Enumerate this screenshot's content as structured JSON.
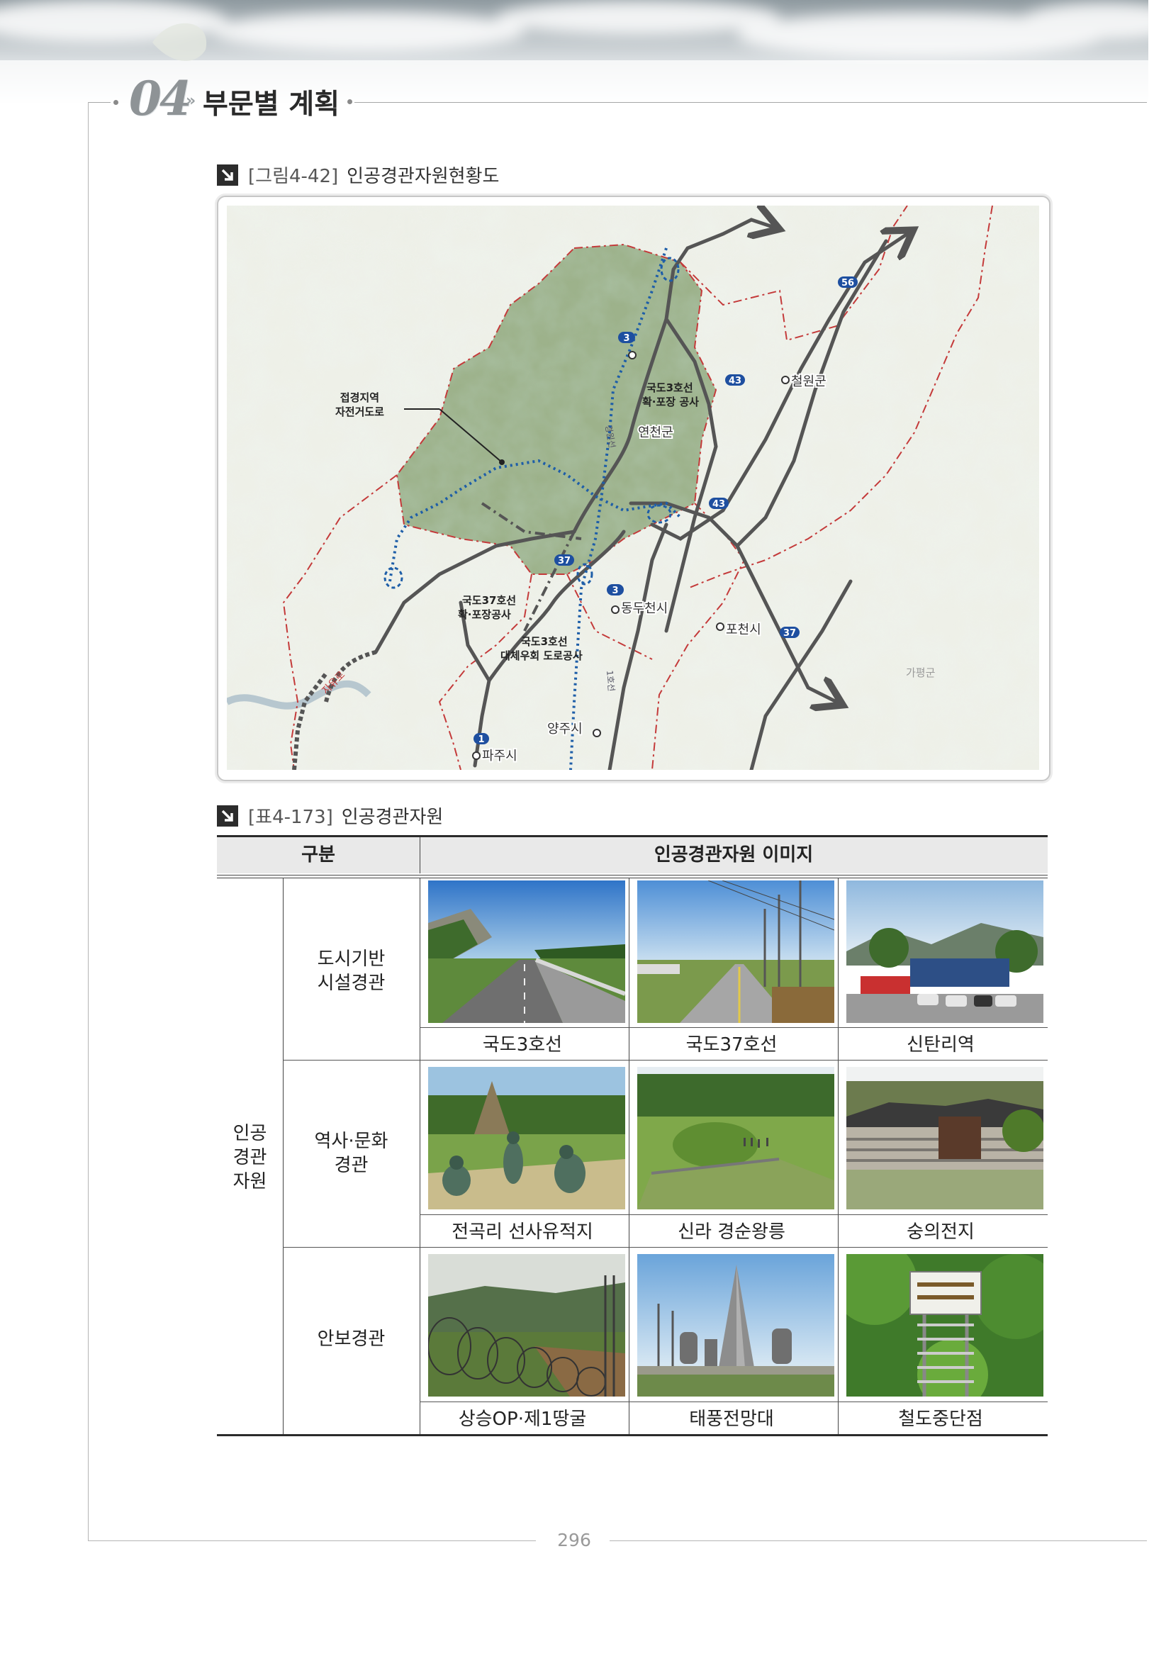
{
  "header": {
    "chapter_number": "04",
    "chapter_title": "부문별 계획"
  },
  "figure": {
    "number": "[그림4-42]",
    "title": "인공경관자원현황도",
    "map_labels": {
      "bike_road": [
        "접경지역",
        "자전거도로"
      ],
      "route3_work": [
        "국도3호선",
        "확·포장 공사"
      ],
      "route37_work": [
        "국도37호선",
        "확·포장공사"
      ],
      "route3_bypass": [
        "국도3호선",
        "대체우회 도로공사"
      ],
      "yeoncheon": "연천군",
      "cheorwon": "철원군",
      "dongducheon": "동두천시",
      "pocheon": "포천시",
      "yangju": "양주시",
      "paju": "파주시",
      "gapyeong": "가평군",
      "jayuro": "자유로",
      "gyeongwon_line": "경원선",
      "line1": "1호선"
    },
    "route_badges": [
      "3",
      "3",
      "37",
      "43",
      "43",
      "56",
      "37",
      "1"
    ]
  },
  "table": {
    "number": "[표4-173]",
    "title": "인공경관자원",
    "header": {
      "category": "구분",
      "images": "인공경관자원 이미지"
    },
    "group": "인공\n경관\n자원",
    "rows": [
      {
        "subcategory": "도시기반\n시설경관",
        "items": [
          "국도3호선",
          "국도37호선",
          "신탄리역"
        ]
      },
      {
        "subcategory": "역사·문화\n경관",
        "items": [
          "전곡리 선사유적지",
          "신라 경순왕릉",
          "숭의전지"
        ]
      },
      {
        "subcategory": "안보경관",
        "items": [
          "상승OP·제1땅굴",
          "태풍전망대",
          "철도중단점"
        ]
      }
    ]
  },
  "footer": {
    "page_number": "296"
  }
}
